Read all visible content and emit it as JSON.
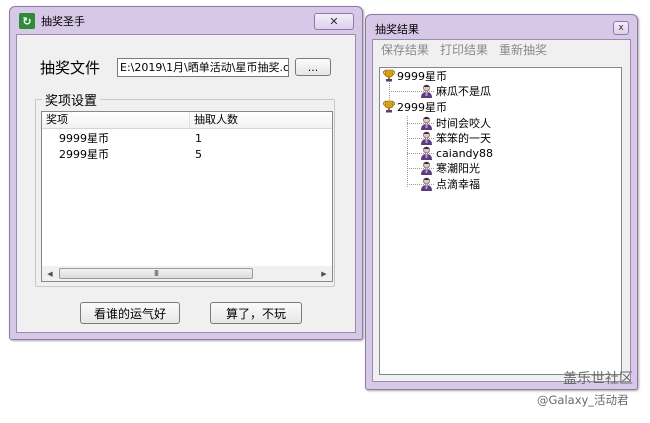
{
  "main_window": {
    "title": "抽奖圣手",
    "file_label": "抽奖文件",
    "file_path": "E:\\2019\\1月\\晒单活动\\星币抽奖.c",
    "browse_label": "...",
    "group_title": "奖项设置",
    "columns": [
      "奖项",
      "抽取人数"
    ],
    "rows": [
      {
        "prize": "9999星币",
        "count": "1"
      },
      {
        "prize": "2999星币",
        "count": "5"
      }
    ],
    "scroll_thumb_label": "III",
    "draw_button": "看谁的运气好",
    "quit_button": "算了，不玩"
  },
  "result_window": {
    "title": "抽奖结果",
    "close_label": "x",
    "toolbar": [
      "保存结果",
      "打印结果",
      "重新抽奖"
    ],
    "tree": [
      {
        "prize": "9999星币",
        "winners": [
          "麻瓜不是瓜"
        ]
      },
      {
        "prize": "2999星币",
        "winners": [
          "时间会咬人",
          "笨笨的一天",
          "caiandy88",
          "寒潮阳光",
          "点滴幸福"
        ]
      }
    ]
  },
  "watermark": {
    "line1": "盖乐世社区",
    "line2": "@Galaxy_活动君"
  },
  "colors": {
    "frame": "#d8c8e8",
    "frame_border": "#8e7aa6",
    "client": "#f0f0f0",
    "trophy": "#d4a017",
    "person": "#5a3d7a"
  }
}
